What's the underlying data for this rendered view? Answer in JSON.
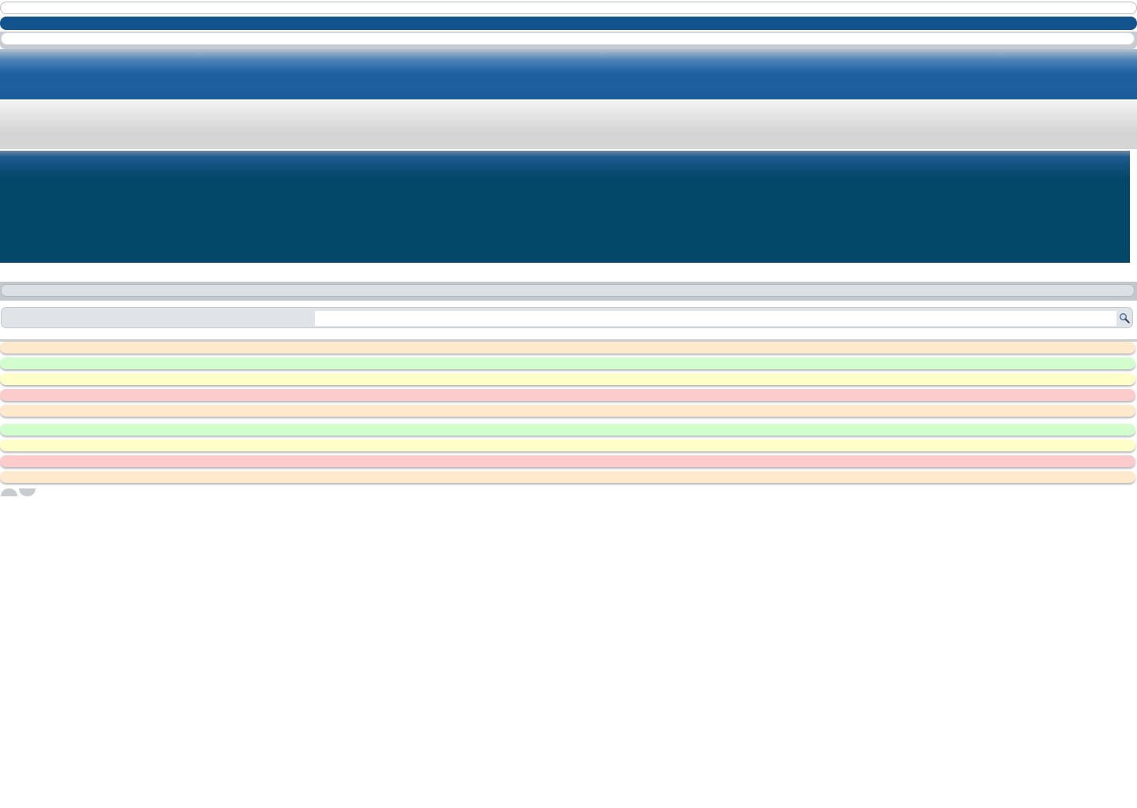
{
  "search": {
    "placeholder": "",
    "value": ""
  },
  "search_button": {
    "icon": "magnifier-icon"
  },
  "status_rows": [
    {
      "color": "#fee9cd",
      "status": "orange"
    },
    {
      "color": "#d2fecd",
      "status": "green"
    },
    {
      "color": "#fefec9",
      "status": "yellow"
    },
    {
      "color": "#fccbcb",
      "status": "red"
    },
    {
      "color": "#fee9cd",
      "status": "orange"
    },
    {
      "color": "#d2fecd",
      "status": "green"
    },
    {
      "color": "#fefec9",
      "status": "yellow"
    },
    {
      "color": "#fccbcb",
      "status": "red"
    },
    {
      "color": "#fee9cd",
      "status": "orange"
    }
  ],
  "colors": {
    "top_bar": "#13548f",
    "header": "#1b5b9b",
    "hero": "#044869",
    "toolbar": "#d6d6d6"
  }
}
